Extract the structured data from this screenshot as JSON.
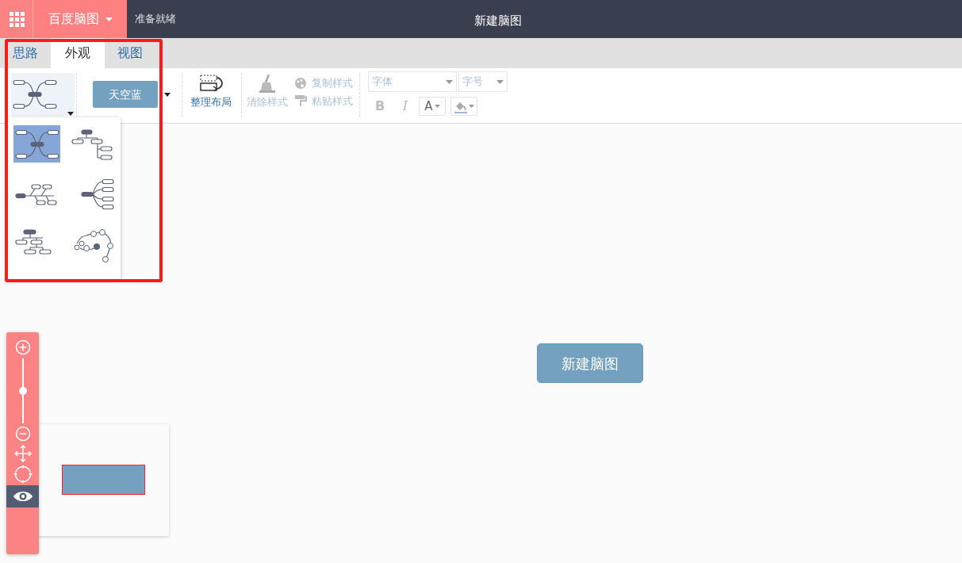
{
  "topbar": {
    "app_menu": "百度脑图",
    "status": "准备就绪",
    "title": "新建脑图"
  },
  "tabs": [
    {
      "label": "思路",
      "selected": false
    },
    {
      "label": "外观",
      "selected": true
    },
    {
      "label": "视图",
      "selected": false
    }
  ],
  "toolbar": {
    "theme": "天空蓝",
    "arrange": {
      "label": "整理布局",
      "disabled": false
    },
    "clear_style": {
      "label": "清除样式",
      "disabled": true
    },
    "copy_style": {
      "label": "复制样式",
      "disabled": true
    },
    "paste_style": {
      "label": "粘贴样式",
      "disabled": true
    },
    "font_placeholder": "字体",
    "size_placeholder": "字号",
    "bold": "B",
    "italic": "I",
    "font_color": "A"
  },
  "templates": [
    {
      "kind": "mind",
      "selected": true
    },
    {
      "kind": "filetree",
      "selected": false
    },
    {
      "kind": "fishbone",
      "selected": false
    },
    {
      "kind": "fan",
      "selected": false
    },
    {
      "kind": "org",
      "selected": false
    },
    {
      "kind": "orbit",
      "selected": false
    }
  ],
  "zoom": {
    "level": 0.5
  },
  "navigator": {
    "visible": true
  },
  "canvas": {
    "root_node": "新建脑图"
  }
}
